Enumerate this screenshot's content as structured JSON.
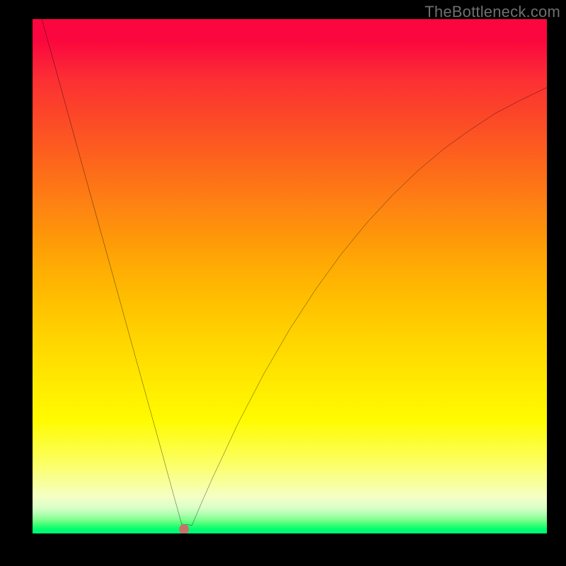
{
  "watermark": "TheBottleneck.com",
  "chart_data": {
    "type": "line",
    "title": "",
    "xlabel": "",
    "ylabel": "",
    "xlim": [
      0,
      100
    ],
    "ylim": [
      0,
      100
    ],
    "grid": false,
    "legend": false,
    "annotations": [
      {
        "kind": "marker-dot",
        "x": 29.5,
        "y": 0.5,
        "color": "#c6746a"
      }
    ],
    "background_gradient": [
      {
        "pos": 0.0,
        "color": "#fb063e"
      },
      {
        "pos": 0.5,
        "color": "#ffab04"
      },
      {
        "pos": 0.8,
        "color": "#ffff00"
      },
      {
        "pos": 0.95,
        "color": "#d8ffc7"
      },
      {
        "pos": 1.0,
        "color": "#00f876"
      }
    ],
    "series": [
      {
        "name": "bottleneck-curve",
        "color": "#000000",
        "x": [
          1.8,
          5,
          10,
          15,
          20,
          25,
          27,
          29,
          31,
          33,
          35,
          40,
          45,
          50,
          55,
          60,
          65,
          70,
          75,
          80,
          85,
          90,
          95,
          100
        ],
        "y": [
          100,
          88.5,
          70.4,
          52.4,
          34.3,
          16.3,
          9.0,
          1.8,
          1.6,
          6.3,
          10.8,
          21.5,
          31.1,
          39.7,
          47.4,
          54.3,
          60.4,
          65.8,
          70.6,
          74.8,
          78.4,
          81.7,
          84.3,
          86.7
        ]
      }
    ],
    "minimum_point": {
      "x": 29.5,
      "y": 0.5
    }
  },
  "dot_style": {
    "left_pct": 29.5,
    "bottom_pct": 0.8
  }
}
